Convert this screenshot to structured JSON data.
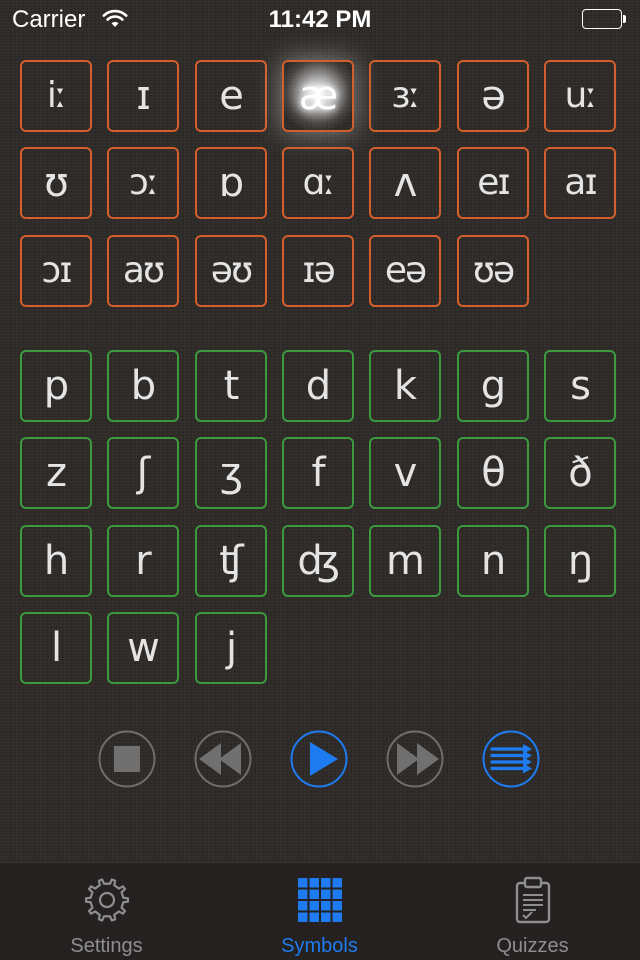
{
  "status_bar": {
    "carrier": "Carrier",
    "time": "11:42 PM"
  },
  "colors": {
    "vowel_border": "#d25f2c",
    "consonant_border": "#3c9a3e",
    "accent": "#1e7cf0",
    "inactive": "#8e8e8e"
  },
  "vowels": [
    "iː",
    "ɪ",
    "e",
    "æ",
    "ɜː",
    "ə",
    "uː",
    "ʊ",
    "ɔː",
    "ɒ",
    "ɑː",
    "ʌ",
    "eɪ",
    "aɪ",
    "ɔɪ",
    "aʊ",
    "əʊ",
    "ɪə",
    "eə",
    "ʊə"
  ],
  "active_vowel": "æ",
  "consonants": [
    "p",
    "b",
    "t",
    "d",
    "k",
    "g",
    "s",
    "z",
    "ʃ",
    "ʒ",
    "f",
    "v",
    "θ",
    "ð",
    "h",
    "r",
    "ʧ",
    "ʤ",
    "m",
    "n",
    "ŋ",
    "l",
    "w",
    "j"
  ],
  "controls": [
    {
      "name": "stop-button",
      "icon": "stop-icon",
      "enabled": false
    },
    {
      "name": "rewind-button",
      "icon": "rewind-icon",
      "enabled": false
    },
    {
      "name": "play-button",
      "icon": "play-icon",
      "enabled": true
    },
    {
      "name": "fast-forward-button",
      "icon": "fast-forward-icon",
      "enabled": false
    },
    {
      "name": "playlist-button",
      "icon": "playlist-icon",
      "enabled": true
    }
  ],
  "tabs": [
    {
      "label": "Settings",
      "icon": "gear-icon",
      "selected": false
    },
    {
      "label": "Symbols",
      "icon": "grid-icon",
      "selected": true
    },
    {
      "label": "Quizzes",
      "icon": "clipboard-icon",
      "selected": false
    }
  ]
}
